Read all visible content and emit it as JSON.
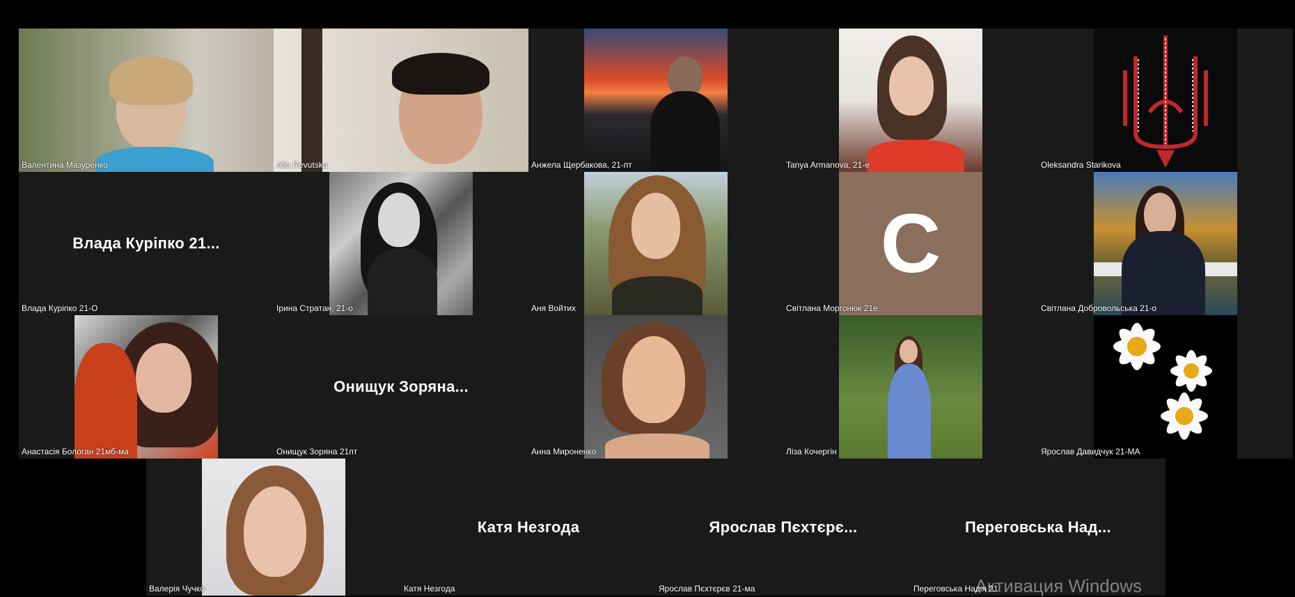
{
  "participants": [
    {
      "name": "Валентина Мазуренко"
    },
    {
      "name": "Alla Revutska"
    },
    {
      "name": "Анжела Щербакова, 21-пт"
    },
    {
      "name": "Tanya Armanova, 21-е"
    },
    {
      "name": "Oleksandra Starikova"
    },
    {
      "name": "Влада Куріпко 21-О",
      "display": "Влада  Куріпко 21..."
    },
    {
      "name": "Ірина Стратан, 21-о"
    },
    {
      "name": "Аня Войтих"
    },
    {
      "name": "Світлана Моргонюк 21е",
      "avatar_letter": "C"
    },
    {
      "name": "Світлана Добровольська 21-о"
    },
    {
      "name": "Анастасія Бологан 21мб-ма"
    },
    {
      "name": "Онищук Зоряна 21пт",
      "display": "Онищук  Зоряна..."
    },
    {
      "name": "Анна Мироненко"
    },
    {
      "name": "Ліза Кочергін"
    },
    {
      "name": "Ярослав Давидчук 21-МА"
    },
    {
      "name": "Валерія Чучко"
    },
    {
      "name": "Катя Незгода",
      "display": "Катя Незгода"
    },
    {
      "name": "Ярослав Пєхтєрєв 21-ма",
      "display": "Ярослав  Пєхтєрє..."
    },
    {
      "name": "Переговська Надія 21",
      "display": "Переговська  Над..."
    }
  ],
  "watermark": "Активация Windows"
}
